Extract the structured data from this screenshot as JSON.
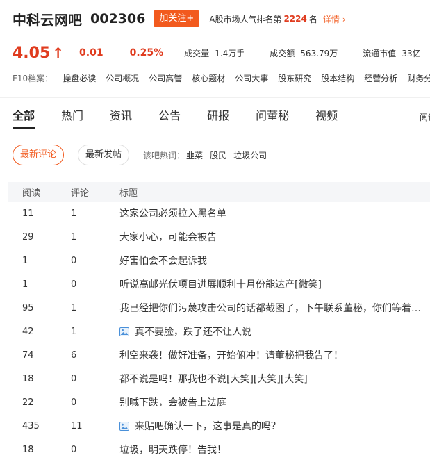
{
  "header": {
    "stock_name": "中科云网吧",
    "stock_code": "002306",
    "follow_label": "加关注+",
    "rank_prefix": "A股市场人气排名第",
    "rank_value": "2224",
    "rank_unit": "名",
    "detail_label": "详情"
  },
  "quote": {
    "price": "4.05",
    "arrow": "↑",
    "change": "0.01",
    "change_pct": "0.25%",
    "volume_label": "成交量",
    "volume_value": "1.4万手",
    "turnover_label": "成交额",
    "turnover_value": "563.79万",
    "float_cap_label": "流通市值",
    "float_cap_value": "33亿",
    "colors": {
      "up": "#e03c1f",
      "accent": "#f25a1e"
    }
  },
  "f10": {
    "label": "F10档案：",
    "items": [
      "操盘必读",
      "公司概况",
      "公司高管",
      "核心题材",
      "公司大事",
      "股东研究",
      "股本结构",
      "经营分析",
      "财务分析"
    ]
  },
  "tabs": {
    "items": [
      "全部",
      "热门",
      "资讯",
      "公告",
      "研报",
      "问董秘",
      "视频"
    ],
    "active_index": 0,
    "right_label": "阅读"
  },
  "filters": {
    "latest_comment": "最新评论",
    "latest_post": "最新发帖",
    "hot_label": "该吧热词：",
    "hot_words": [
      "韭菜",
      "股民",
      "垃圾公司"
    ]
  },
  "table": {
    "headers": {
      "read": "阅读",
      "comment": "评论",
      "title": "标题"
    },
    "rows": [
      {
        "read": "11",
        "comment": "1",
        "title": "这家公司必须拉入黑名单",
        "has_image": false
      },
      {
        "read": "29",
        "comment": "1",
        "title": "大家小心，可能会被告",
        "has_image": false
      },
      {
        "read": "1",
        "comment": "0",
        "title": "好害怕会不会起诉我",
        "has_image": false
      },
      {
        "read": "1",
        "comment": "0",
        "title": "听说高邮光伏项目进展顺利十月份能达产[微笑]",
        "has_image": false
      },
      {
        "read": "95",
        "comment": "1",
        "title": "我已经把你们污蔑攻击公司的话都截图了，下午联系董秘，你们等着吃官司吧",
        "has_image": false
      },
      {
        "read": "42",
        "comment": "1",
        "title": "真不要脸，跌了还不让人说",
        "has_image": true
      },
      {
        "read": "74",
        "comment": "6",
        "title": "利空来袭！做好准备，开始俯冲！请董秘把我告了！",
        "has_image": false
      },
      {
        "read": "18",
        "comment": "0",
        "title": "都不说是吗！那我也不说[大笑][大笑][大笑]",
        "has_image": false
      },
      {
        "read": "22",
        "comment": "0",
        "title": "别喊下跌，会被告上法庭",
        "has_image": false
      },
      {
        "read": "435",
        "comment": "11",
        "title": "来贴吧确认一下，这事是真的吗？",
        "has_image": true
      },
      {
        "read": "18",
        "comment": "0",
        "title": "垃圾，明天跌停！告我！",
        "has_image": false
      }
    ]
  }
}
